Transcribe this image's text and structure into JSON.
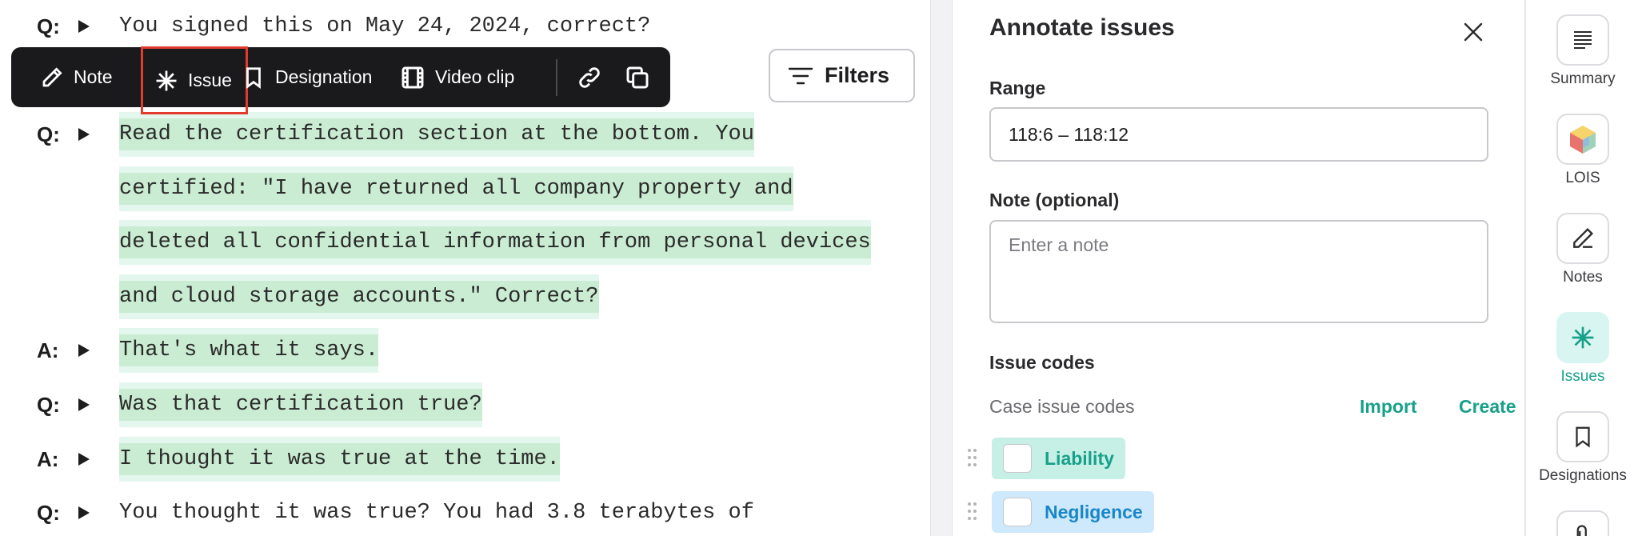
{
  "transcript": {
    "lines": [
      {
        "speaker": "Q:",
        "text": "You signed this on May 24, 2024, correct?",
        "highlighted": false
      },
      {
        "speaker": "Q:",
        "text": "Read the certification section at the bottom. You",
        "highlighted": true
      },
      {
        "speaker": "",
        "text": "certified: \"I have returned all company property and",
        "highlighted": true
      },
      {
        "speaker": "",
        "text": "deleted all confidential information from personal devices",
        "highlighted": true
      },
      {
        "speaker": "",
        "text": "and cloud storage accounts.\" Correct?",
        "highlighted": true
      },
      {
        "speaker": "A:",
        "text": "That's what it says.",
        "highlighted": true
      },
      {
        "speaker": "Q:",
        "text": "Was that certification true?",
        "highlighted": true
      },
      {
        "speaker": "A:",
        "text": "I thought it was true at the time.",
        "highlighted": true
      },
      {
        "speaker": "Q:",
        "text": "You thought it was true? You had 3.8 terabytes of",
        "highlighted": false
      }
    ]
  },
  "toolbar": {
    "note_label": "Note",
    "issue_label": "Issue",
    "designation_label": "Designation",
    "video_label": "Video clip"
  },
  "filters": {
    "label": "Filters"
  },
  "annotate": {
    "title": "Annotate issues",
    "range_label": "Range",
    "range_value": "118:6 – 118:12",
    "note_label": "Note (optional)",
    "note_placeholder": "Enter a note",
    "issue_codes_label": "Issue codes",
    "case_codes_label": "Case issue codes",
    "import_label": "Import",
    "create_label": "Create",
    "codes": [
      {
        "name": "Liability",
        "bg": "#c6efe6",
        "color": "#17a08a"
      },
      {
        "name": "Negligence",
        "bg": "#cde9fb",
        "color": "#1a86c9"
      }
    ]
  },
  "rail": {
    "items": [
      {
        "label": "Summary",
        "icon": "summary-icon",
        "active": false
      },
      {
        "label": "LOIS",
        "icon": "lois-icon",
        "active": false
      },
      {
        "label": "Notes",
        "icon": "pen-icon",
        "active": false
      },
      {
        "label": "Issues",
        "icon": "asterisk-icon",
        "active": true
      },
      {
        "label": "Designations",
        "icon": "bookmark-icon",
        "active": false
      }
    ]
  },
  "colors": {
    "accent": "#17a08a",
    "highlight": "#c9ecd2",
    "toolbar_bg": "#1a1a1c",
    "selected_outline": "#e23b2e"
  }
}
